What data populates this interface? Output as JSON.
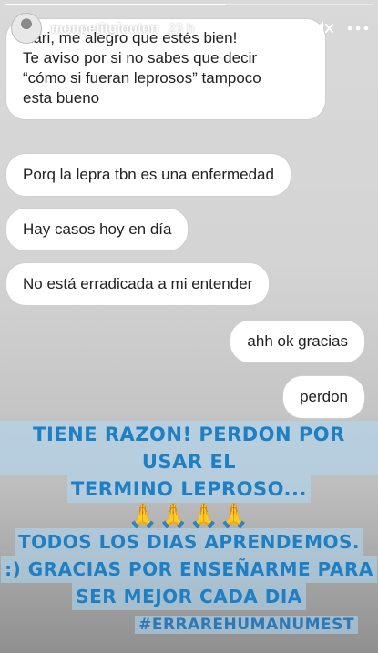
{
  "story": {
    "progress": 0.6,
    "username": "monpetitglouton",
    "time": "23 h"
  },
  "messages": [
    {
      "side": "left",
      "text_lines": [
        "Kari, me alegro que estés bien!",
        "Te aviso por si no sabes que decir",
        "“cómo si fueran leprosos” tampoco",
        "esta bueno"
      ]
    },
    {
      "side": "left",
      "text": "Porq la lepra tbn es una enfermedad"
    },
    {
      "side": "left",
      "text": "Hay casos hoy en día"
    },
    {
      "side": "left",
      "text": "No está erradicada a mi entender"
    },
    {
      "side": "right",
      "text": "ahh ok gracias"
    },
    {
      "side": "right",
      "text": "perdon"
    }
  ],
  "overlay": {
    "line1": "TIENE RAZON! PERDON POR USAR EL",
    "line2": "TERMINO LEPROSO...",
    "emoji": "🙏🙏🙏🙏",
    "line3": "TODOS LOS DIAS APRENDEMOS.",
    "line4": ":) GRACIAS POR ENSEÑARME PARA",
    "line5": "SER MEJOR CADA DIA",
    "hashtag": "#ERRAREHUMANUMEST"
  },
  "icons": {
    "play": "play-icon",
    "mute": "mute-icon",
    "more": "more-options-icon"
  },
  "colors": {
    "overlay_text": "#1f7fc4",
    "highlight": "#add8f4"
  }
}
